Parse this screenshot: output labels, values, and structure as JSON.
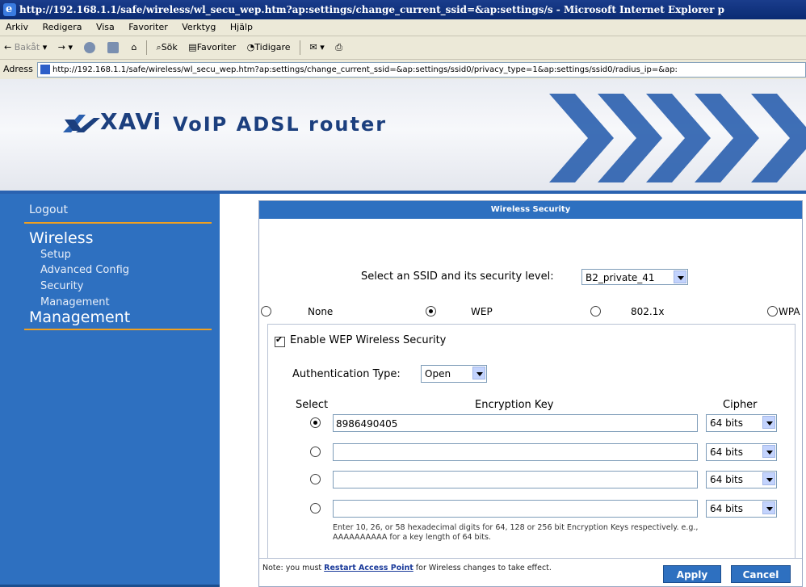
{
  "window": {
    "title": "http://192.168.1.1/safe/wireless/wl_secu_wep.htm?ap:settings/change_current_ssid=&ap:settings/s - Microsoft Internet Explorer p"
  },
  "menu": [
    "Arkiv",
    "Redigera",
    "Visa",
    "Favoriter",
    "Verktyg",
    "Hjälp"
  ],
  "toolbar": {
    "back": "Bakåt",
    "search": "Sök",
    "favorites": "Favoriter",
    "history": "Tidigare"
  },
  "address": {
    "label": "Adress",
    "url": "http://192.168.1.1/safe/wireless/wl_secu_wep.htm?ap:settings/change_current_ssid=&ap:settings/ssid0/privacy_type=1&ap:settings/ssid0/radius_ip=&ap:"
  },
  "banner": {
    "brand": "XAVi",
    "product": "VoIP ADSL router"
  },
  "sidebar": {
    "logout": "Logout",
    "wireless_section": "Wireless",
    "items": [
      "Setup",
      "Advanced Config",
      "Security",
      "Management"
    ],
    "management_section": "Management"
  },
  "panel": {
    "title": "Wireless Security",
    "ssid_label": "Select an SSID and its security level:",
    "ssid_value": "B2_private_41",
    "levels": [
      "None",
      "WEP",
      "802.1x",
      "WPA"
    ],
    "selected_level": "WEP",
    "enable_label": "Enable WEP Wireless Security",
    "enable_checked": true,
    "auth_label": "Authentication Type:",
    "auth_value": "Open",
    "col_select": "Select",
    "col_key": "Encryption Key",
    "col_cipher": "Cipher",
    "keys": [
      {
        "value": "8986490405",
        "cipher": "64 bits",
        "selected": true
      },
      {
        "value": "",
        "cipher": "64 bits",
        "selected": false
      },
      {
        "value": "",
        "cipher": "64 bits",
        "selected": false
      },
      {
        "value": "",
        "cipher": "64 bits",
        "selected": false
      }
    ],
    "hint": "Enter 10, 26, or 58 hexadecimal digits for 64, 128 or 256 bit Encryption Keys respectively. e.g., AAAAAAAAAA for a key length of 64 bits.",
    "note_prefix": "Note: you must ",
    "note_link": "Restart Access Point",
    "note_suffix": " for Wireless changes to take effect.",
    "apply": "Apply",
    "cancel": "Cancel"
  },
  "colors": {
    "nav_blue": "#2e70c0",
    "accent_orange": "#f0a020"
  }
}
